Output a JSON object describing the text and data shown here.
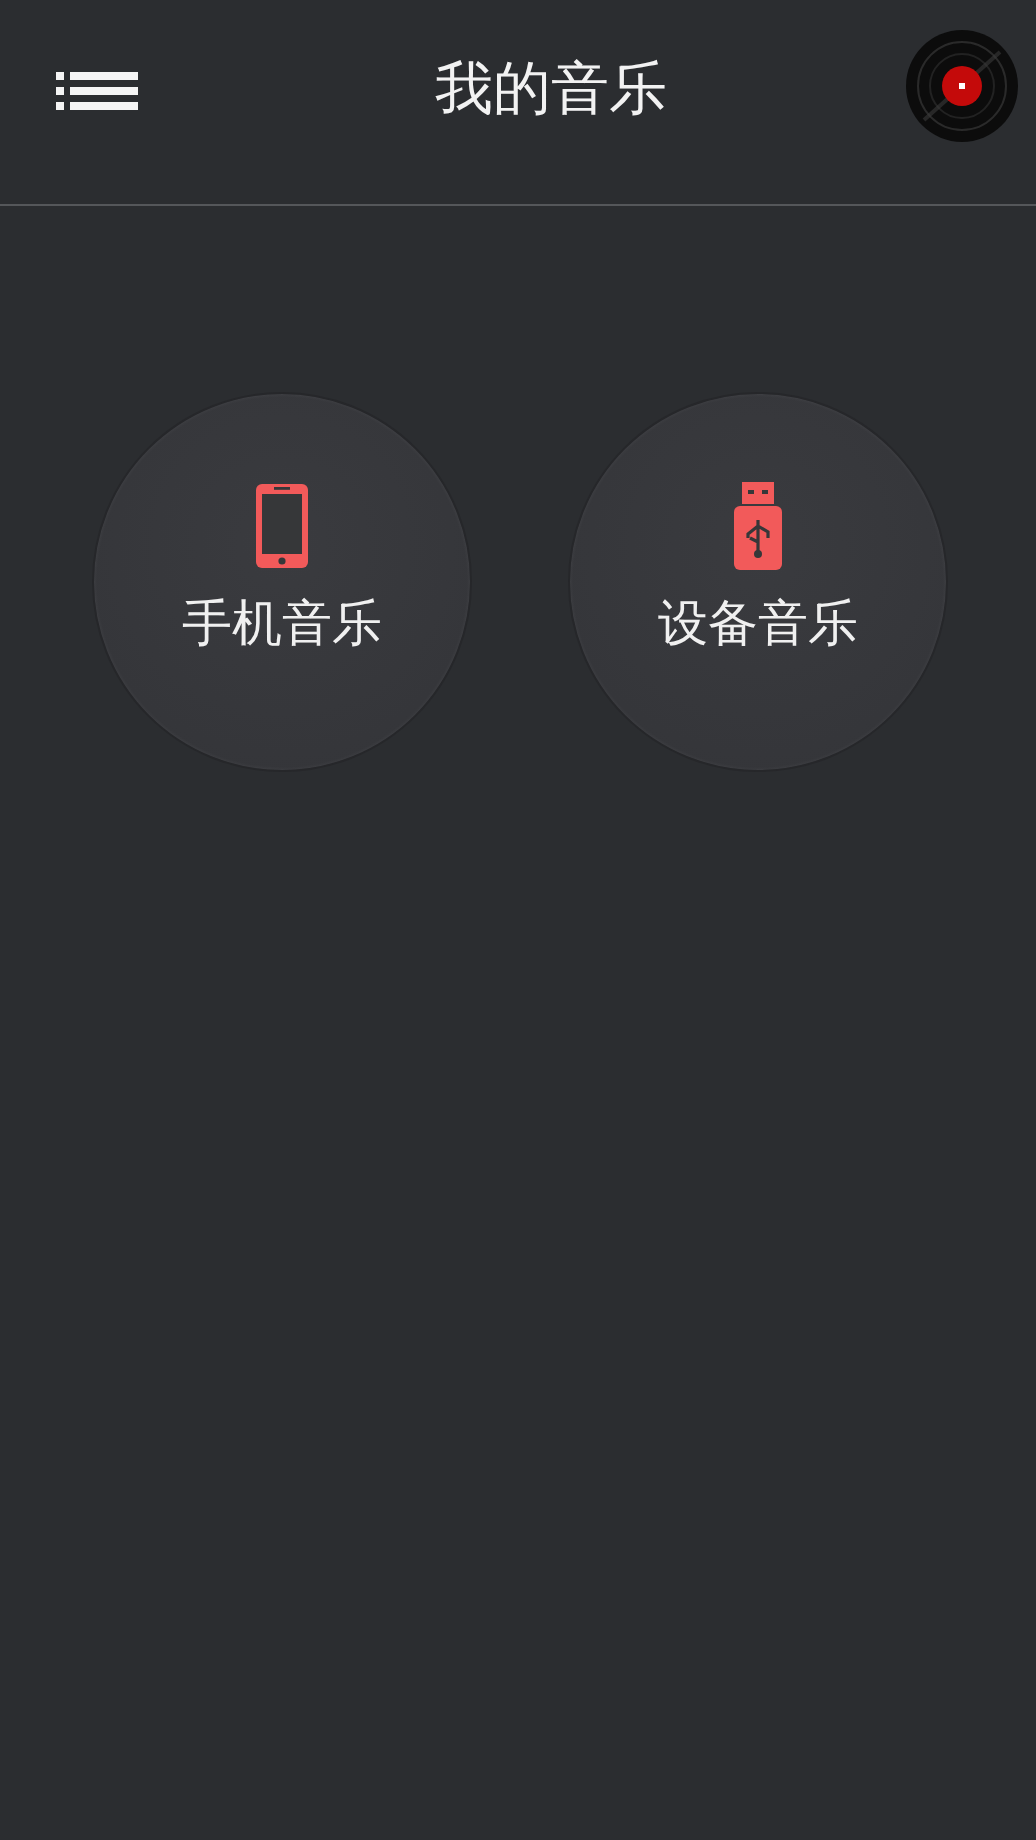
{
  "header": {
    "title": "我的音乐"
  },
  "sources": [
    {
      "kind": "phone",
      "label": "手机音乐"
    },
    {
      "kind": "usb",
      "label": "设备音乐"
    }
  ]
}
